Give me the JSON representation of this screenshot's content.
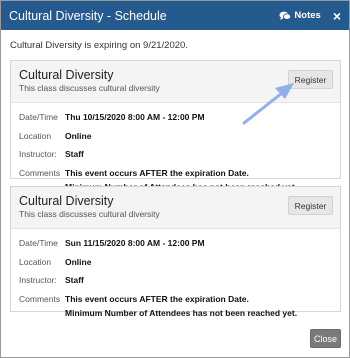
{
  "dialog": {
    "title": "Cultural Diversity - Schedule",
    "notes_label": "Notes",
    "close_x": "×",
    "expiry_text": "Cultural Diversity is expiring on 9/21/2020."
  },
  "labels": {
    "datetime": "Date/Time",
    "location": "Location",
    "instructor": "Instructor:",
    "comments": "Comments"
  },
  "events": [
    {
      "title": "Cultural Diversity",
      "description": "This class discusses cultural diversity",
      "register_label": "Register",
      "datetime": "Thu 10/15/2020 8:00 AM - 12:00 PM",
      "location": "Online",
      "instructor": "Staff",
      "comment_1": "This event occurs AFTER the expiration Date.",
      "comment_2": "Minimum Number of Attendees has not been reached yet."
    },
    {
      "title": "Cultural Diversity",
      "description": "This class discusses cultural diversity",
      "register_label": "Register",
      "datetime": "Sun 11/15/2020 8:00 AM - 12:00 PM",
      "location": "Online",
      "instructor": "Staff",
      "comment_1": "This event occurs AFTER the expiration Date.",
      "comment_2": "Minimum Number of Attendees has not been reached yet."
    }
  ],
  "footer": {
    "close_label": "Close"
  },
  "colors": {
    "header_bg": "#255a8f",
    "arrow": "#8fb0e8",
    "close_button": "#7a7a7a"
  },
  "icons": {
    "notes": "chat-bubbles-icon",
    "annotation": "arrow-icon"
  }
}
